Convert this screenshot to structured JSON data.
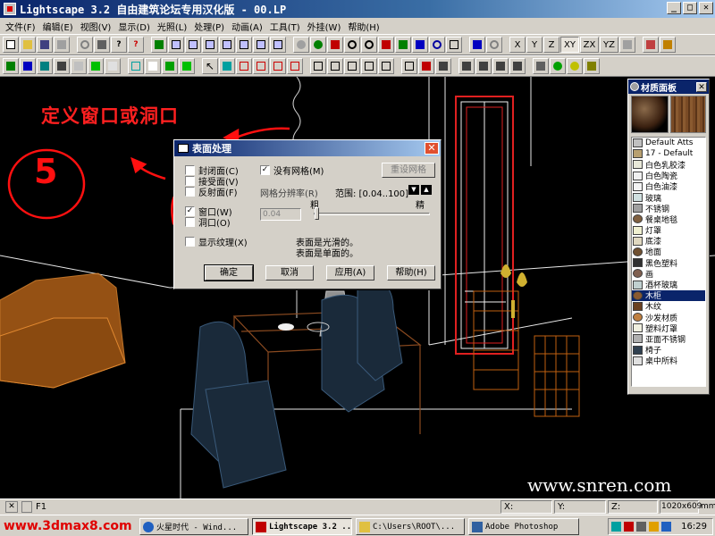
{
  "window": {
    "title": "Lightscape 3.2 自由建筑论坛专用汉化版  - 00.LP",
    "btn_min": "_",
    "btn_max": "□",
    "btn_close": "✕"
  },
  "menu": [
    "文件(F)",
    "编辑(E)",
    "视图(V)",
    "显示(D)",
    "光照(L)",
    "处理(P)",
    "动画(A)",
    "工具(T)",
    "外挂(W)",
    "帮助(H)"
  ],
  "axes": {
    "x": "X",
    "y": "Y",
    "z": "Z",
    "xy": "XY",
    "zx": "ZX",
    "yz": "YZ"
  },
  "annotation": {
    "title": "定义窗口或洞口",
    "step": "5"
  },
  "watermark": "www.snren.com",
  "material_panel": {
    "title": "材质面板",
    "items": [
      {
        "label": "Default Atts",
        "color": "#c0c0c0"
      },
      {
        "label": "17 - Default",
        "color": "#b8a070"
      },
      {
        "label": "白色乳胶漆",
        "color": "#e8e8d8"
      },
      {
        "label": "白色陶瓷",
        "color": "#f0f0f0"
      },
      {
        "label": "白色油漆",
        "color": "#f4f4f4"
      },
      {
        "label": "玻璃",
        "color": "#d0e0e0"
      },
      {
        "label": "不锈钢",
        "color": "#a0a0a0"
      },
      {
        "label": "餐桌地毯",
        "color": "#806040"
      },
      {
        "label": "灯罩",
        "color": "#f0f0d0"
      },
      {
        "label": "底漆",
        "color": "#e0d8c0"
      },
      {
        "label": "地面",
        "color": "#705030"
      },
      {
        "label": "黑色塑料",
        "color": "#303030"
      },
      {
        "label": "画",
        "color": "#806050"
      },
      {
        "label": "酒杯玻璃",
        "color": "#c0d0d0"
      },
      {
        "label": "木柜",
        "color": "#8a5a30"
      },
      {
        "label": "木纹",
        "color": "#6a4020"
      },
      {
        "label": "沙发材质",
        "color": "#c08040"
      },
      {
        "label": "塑料灯罩",
        "color": "#f0f0e0"
      },
      {
        "label": "亚面不锈钢",
        "color": "#b0b0b0"
      },
      {
        "label": "椅子",
        "color": "#304050"
      },
      {
        "label": "桌中所料",
        "color": "#e0e0e0"
      }
    ],
    "selected": "木柜"
  },
  "dialog": {
    "title": "表面处理",
    "opt_closed": "封闭面(C)",
    "opt_receive": "接受面(V)",
    "opt_reflect": "反射面(F)",
    "opt_window": "窗口(W)",
    "opt_opening": "洞口(O)",
    "opt_show_tex": "显示纹理(X)",
    "opt_no_mesh": "没有网格(M)",
    "btn_reset_mesh": "重设网格",
    "mesh_label": "网格分辨率(R)",
    "range": "范围: [0.04..100]",
    "value": "0.04",
    "coarse": "粗",
    "fine": "精",
    "info1": "表面是光滑的。",
    "info2": "表面是单面的。",
    "btn_ok": "确定",
    "btn_cancel": "取消",
    "btn_apply": "应用(A)",
    "btn_help": "帮助(H)"
  },
  "status": {
    "cmd": "F1",
    "x": "X:",
    "y": "Y:",
    "z": "Z:",
    "res": "1020x609",
    "mm": "mm"
  },
  "taskbar": {
    "site": "www.3dmax8.com",
    "tasks": [
      "火星时代 - Wind...",
      "Lightscape 3.2 ...",
      "C:\\Users\\ROOT\\...",
      "Adobe Photoshop"
    ],
    "clock": "16:29"
  }
}
